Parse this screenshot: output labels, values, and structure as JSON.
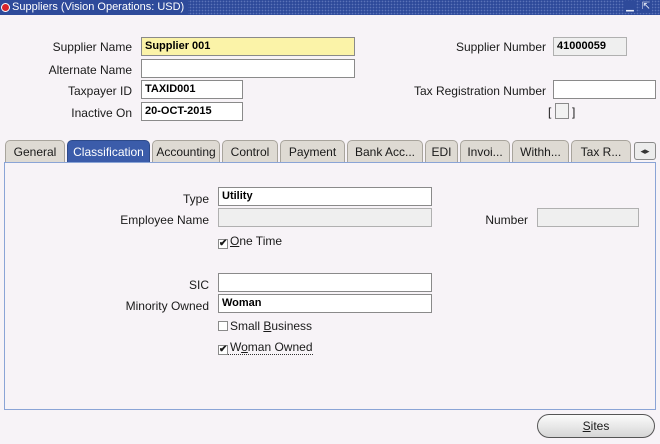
{
  "window": {
    "title": "Suppliers (Vision Operations: USD)",
    "icons": [
      "app-icon",
      "minimize-icon",
      "maximize-icon"
    ]
  },
  "header": {
    "supplier_name_label": "Supplier Name",
    "supplier_name_value": "Supplier 001",
    "alternate_name_label": "Alternate Name",
    "alternate_name_value": "",
    "taxpayer_id_label": "Taxpayer ID",
    "taxpayer_id_value": "TAXID001",
    "inactive_on_label": "Inactive On",
    "inactive_on_value": "20-OCT-2015",
    "supplier_number_label": "Supplier Number",
    "supplier_number_value": "41000059",
    "tax_registration_label": "Tax Registration Number",
    "tax_registration_value": "",
    "bracket_open": "[",
    "bracket_close": "]"
  },
  "tabs": [
    {
      "label": "General",
      "active": false
    },
    {
      "label": "Classification",
      "active": true
    },
    {
      "label": "Accounting",
      "active": false
    },
    {
      "label": "Control",
      "active": false
    },
    {
      "label": "Payment",
      "active": false
    },
    {
      "label": "Bank Acc...",
      "active": false
    },
    {
      "label": "EDI",
      "active": false
    },
    {
      "label": "Invoi...",
      "active": false
    },
    {
      "label": "Withh...",
      "active": false
    },
    {
      "label": "Tax R...",
      "active": false
    }
  ],
  "tab_scroll_icon": "◂▸",
  "classification": {
    "type_label": "Type",
    "type_value": "Utility",
    "employee_name_label": "Employee Name",
    "employee_name_value": "",
    "number_label": "Number",
    "number_value": "",
    "one_time": {
      "mnemonic": "O",
      "rest": "ne Time",
      "checked": true
    },
    "sic_label": "SIC",
    "sic_value": "",
    "minority_owned_label": "Minority Owned",
    "minority_owned_value": "Woman",
    "small_business": {
      "before": "Small ",
      "mnemonic": "B",
      "rest": "usiness",
      "checked": false
    },
    "woman_owned": {
      "before": "W",
      "mnemonic": "o",
      "rest": "man Owned",
      "checked": true
    },
    "check_mark": "✔"
  },
  "footer": {
    "sites_mnemonic": "S",
    "sites_rest": "ites"
  },
  "colors": {
    "titlebar": "#2e4a9a",
    "active_tab": "#3b5caa",
    "required_field": "#fbf3a8",
    "background": "#f7f3f7"
  }
}
